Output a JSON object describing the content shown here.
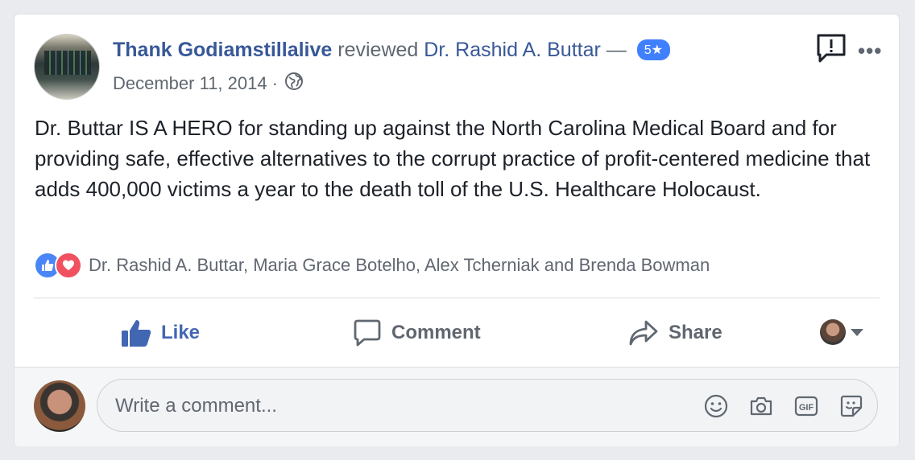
{
  "review": {
    "author": "Thank Godiamstillalive",
    "verb": "reviewed",
    "subject": "Dr. Rashid A. Buttar",
    "dash": "—",
    "rating": "5★",
    "date": "December 11, 2014",
    "separator": "·",
    "text": "Dr. Buttar IS A HERO for standing up against the North Carolina Medical Board and for providing safe, effective alternatives to the corrupt practice of profit-centered medicine that adds 400,000 victims a year to the death toll of the U.S. Healthcare Holocaust."
  },
  "reactions": {
    "names": "Dr. Rashid A. Buttar, Maria Grace Botelho, Alex Tcherniak and Brenda Bowman",
    "types": [
      "like-icon",
      "love-icon"
    ]
  },
  "actions": {
    "like": "Like",
    "comment": "Comment",
    "share": "Share"
  },
  "comment": {
    "placeholder": "Write a comment..."
  },
  "colors": {
    "name": "#385898",
    "like_active": "#4267b2",
    "rating_badge": "#4080ff",
    "love": "#f0505f"
  }
}
